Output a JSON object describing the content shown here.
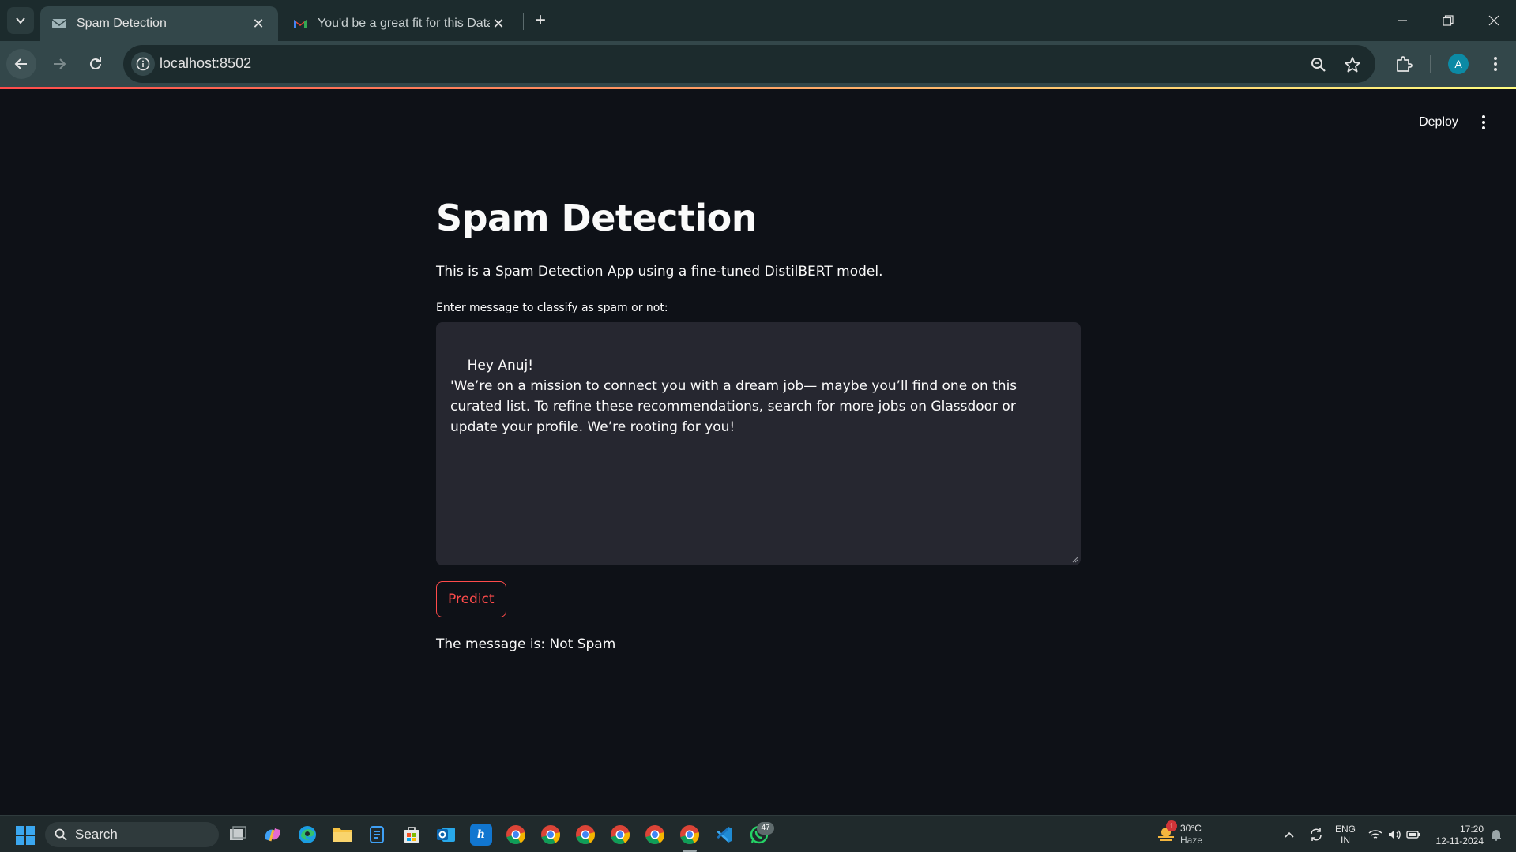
{
  "browser": {
    "tabs": [
      {
        "title": "Spam Detection",
        "active": true
      },
      {
        "title": "You'd be a great fit for this Data",
        "active": false
      }
    ],
    "url": "localhost:8502",
    "profile_initial": "A"
  },
  "app": {
    "deploy_label": "Deploy",
    "title": "Spam Detection",
    "description": "This is a Spam Detection App using a fine-tuned DistilBERT model.",
    "input_label": "Enter message to classify as spam or not:",
    "message_value": "Hey Anuj!\n'We’re on a mission to connect you with a dream job— maybe you’ll find one on this curated list. To refine these recommendations, search for more jobs on Glassdoor or update your profile. We’re rooting for you!",
    "predict_label": "Predict",
    "result": "The message is: Not Spam",
    "colors": {
      "accent": "#ff4b4b",
      "background": "#0e1117",
      "input_bg": "#262730"
    }
  },
  "taskbar": {
    "search_label": "Search",
    "weather_temp": "30°C",
    "weather_desc": "Haze",
    "weather_badge": "1",
    "language": "ENG",
    "region": "IN",
    "time": "17:20",
    "date": "12-11-2024",
    "whatsapp_badge": "47",
    "apps": [
      "task-view-icon",
      "copilot-icon",
      "edge-icon",
      "file-explorer-icon",
      "app-icon",
      "store-icon",
      "outlook-icon",
      "hp-icon",
      "chrome-icon",
      "chrome-icon",
      "chrome-icon",
      "chrome-icon",
      "chrome-icon",
      "chrome-icon",
      "vscode-icon",
      "whatsapp-icon"
    ]
  }
}
